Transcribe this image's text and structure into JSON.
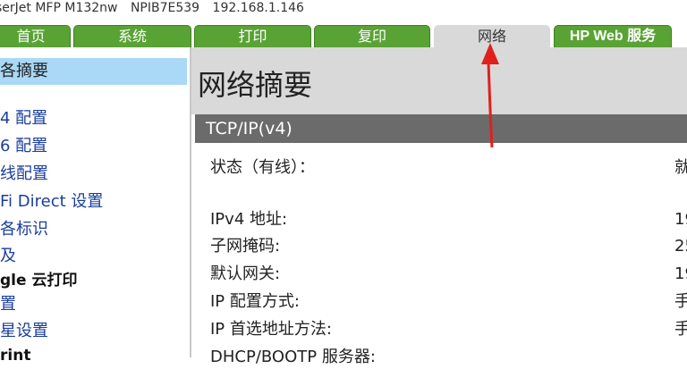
{
  "header": {
    "model": "serJet MFP M132nw",
    "hostname": "NPIB7E539",
    "ip": "192.168.1.146"
  },
  "tabs": [
    {
      "label": "首页"
    },
    {
      "label": "系统"
    },
    {
      "label": "打印"
    },
    {
      "label": "复印"
    },
    {
      "label": "网络"
    },
    {
      "label": "HP Web 服务"
    }
  ],
  "sidebar": {
    "items": [
      {
        "label": "各摘要"
      },
      {
        "label": "4 配置"
      },
      {
        "label": "6 配置"
      },
      {
        "label": "线配置"
      },
      {
        "label": "Fi Direct 设置"
      },
      {
        "label": "各标识"
      },
      {
        "label": "及"
      },
      {
        "label": "gle 云打印"
      },
      {
        "label": "置"
      },
      {
        "label": "星设置"
      },
      {
        "label": "rint"
      }
    ]
  },
  "main": {
    "title": "网络摘要",
    "section": "TCP/IP(v4)",
    "rows": [
      {
        "label": "状态（有线）：",
        "value": "就"
      },
      {
        "label": "IPv4 地址:",
        "value": "19"
      },
      {
        "label": "子网掩码:",
        "value": "25"
      },
      {
        "label": "默认网关:",
        "value": "19"
      },
      {
        "label": "IP 配置方式:",
        "value": "手"
      },
      {
        "label": "IP 首选地址方法:",
        "value": "手"
      },
      {
        "label": "DHCP/BOOTP 服务器:",
        "value": ""
      }
    ]
  },
  "colors": {
    "tab_green": "#59a335",
    "active_tab": "#d9d9d9",
    "sidebar_active": "#a9d9f6",
    "section_header": "#6b6b6b",
    "link_blue": "#1a3e9c",
    "annotation_arrow": "#e0201b"
  }
}
